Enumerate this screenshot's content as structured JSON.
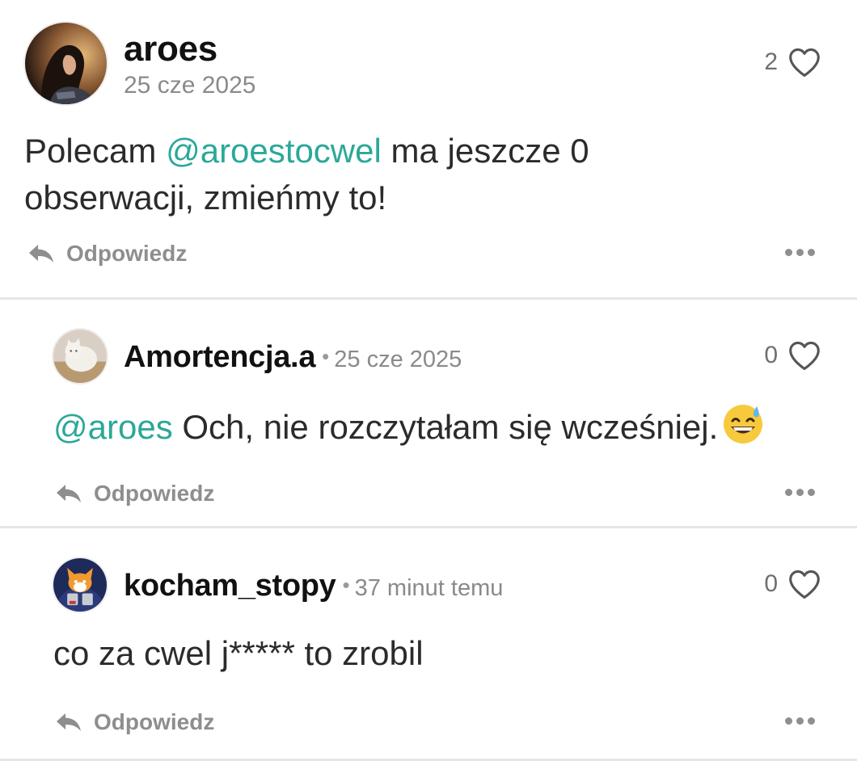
{
  "comments": [
    {
      "username": "aroes",
      "date": "25 cze 2025",
      "likes": "2",
      "text_line1_prefix": "Polecam ",
      "text_mention": "@aroestocwel",
      "text_line1_suffix": " ma jeszcze 0",
      "text_line2": "obserwacji, zmieńmy to!",
      "reply_label": "Odpowiedz"
    },
    {
      "username": "Amortencja.a",
      "separator": "•",
      "date": "25 cze 2025",
      "likes": "0",
      "text_mention": "@aroes",
      "text": " Och, nie rozczytałam się wcześniej.",
      "emoji": "sweat-smile-emoji",
      "reply_label": "Odpowiedz"
    },
    {
      "username": "kocham_stopy",
      "separator": "•",
      "date": "37 minut temu",
      "likes": "0",
      "text": "co za cwel j***** to zrobil",
      "reply_label": "Odpowiedz"
    }
  ],
  "colors": {
    "mention": "#2ba898",
    "muted": "#8a8a8a",
    "divider": "#e6e6e6"
  }
}
